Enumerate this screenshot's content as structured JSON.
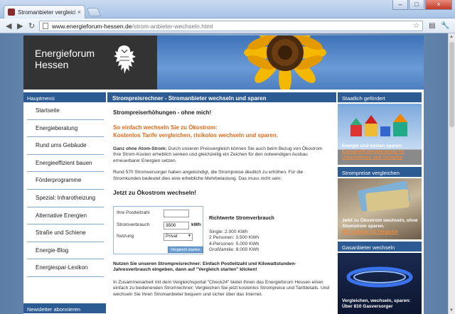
{
  "browser": {
    "tab_title": "Stromanbieter vergleichen...",
    "tab_close": "×",
    "url_host": "www.energieforum-hessen.de",
    "url_path": "/strom-anbieter-wechseln.html"
  },
  "header": {
    "brand_line1": "Energieforum",
    "brand_line2": "Hessen"
  },
  "leftnav": {
    "heading": "Hauptmenü",
    "items": [
      "Startseite",
      "Energieberatung",
      "Rund ums Gebäude",
      "Energieeffizient bauen",
      "Förderprogramme",
      "Spezial: Infrarotheizung",
      "Alternative Energien",
      "Straße und Schiene",
      "Energie-Blog",
      "Energiespar-Lexikon"
    ],
    "newsletter_heading": "Newsletter abonnieren"
  },
  "main": {
    "heading": "Strompreisrechner - Stromanbieter wechseln und sparen",
    "h1": "Strompreiserhöhungen - ohne mich!",
    "h2_line1": "So einfach wechseln Sie zu Ökostrom:",
    "h2_line2": "Kostenlos Tarife vergleichen, risikolos wechseln und sparen.",
    "p1_bold": "Ganz ohne Atom-Strom:",
    "p1_rest": " Durch unseren Preisvergleich können Sie auch beim Bezug von Ökostrom Ihre Strom-Kosten erheblich senken und gleichzeitig ein Zeichen für den notwendigen Ausbau erneuerbarer Energien setzen.",
    "p2": "Rund 570 Stromversorger haben angekündigt, die Strompreise deutlich zu erhöhen. Für die Stromkunden bedeutet dies eine erhebliche Mehrbelastung. Das muss nicht sein:",
    "h3": "Jetzt zu Ökostrom wechseln!",
    "calc": {
      "plz_label": "Ihre Postleitzahl",
      "plz_value": "",
      "verbrauch_label": "Stromverbrauch",
      "verbrauch_value": "3500",
      "unit": "kWh",
      "nutzung_label": "Nutzung",
      "nutzung_value": "Privat",
      "button": "Vergleich starten"
    },
    "richtwerte": {
      "title": "Richtwerte Stromverbrauch",
      "lines": [
        "Single: 2.000 KWh",
        "2 Personen: 3.500 KWh",
        "4-Personen: 5.000 KWh",
        "Großfamilie: 8.000 KWh"
      ]
    },
    "p3": "Nutzen Sie unseren Strompreisrechner: Einfach Postleitzahl und Kilowattstunden-Jahresverbrauch eingeben, dann auf \"Vergleich starten\" klicken!",
    "p4": "In Zusammenarbeit mit dem Vergleichsportal \"Check24\" bietet Ihnen das Energieforum Hessen einen einfach zu bedienenden Stromrechner: Vergleichen Sie jetzt kostenlos Strompreise und Tarifdetails. Und wechseln Sie Ihren Stromanbieter bequem und sicher über das Internet."
  },
  "right": {
    "boxes": [
      {
        "heading": "Staatlich gefördert",
        "caption": "Energie und kosten sparen:",
        "link": "Energieeffizienzberatung für Unternehmen und Gewerbe"
      },
      {
        "heading": "Strompreise vergleichen",
        "caption": "Jetzt zu Ökostrom wechseln, ohne Atomstrom sparen.",
        "link": "900 Anbieter im Vergleich"
      },
      {
        "heading": "Gasanbieter wechseln",
        "caption": "Vergleichen, wechseln, sparen: Über 810 Gasversorger",
        "link": ""
      }
    ]
  }
}
